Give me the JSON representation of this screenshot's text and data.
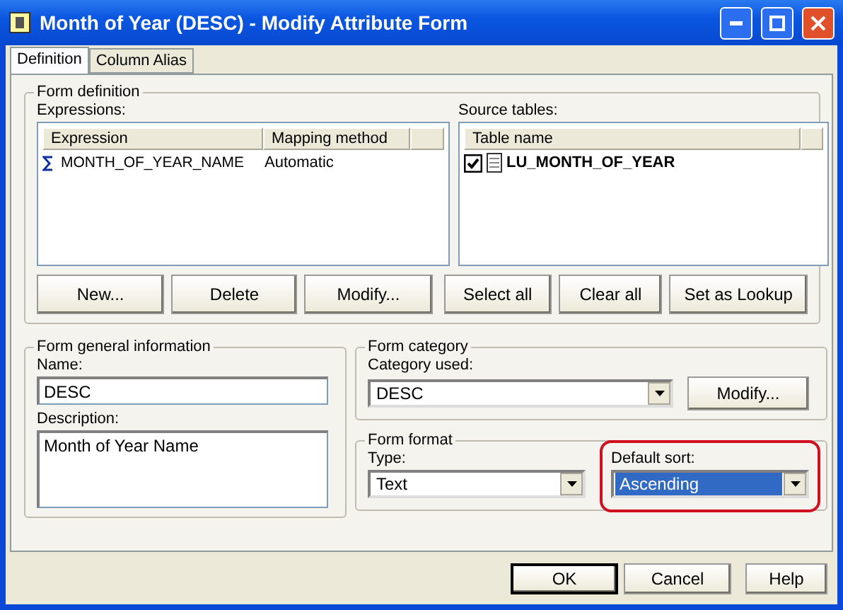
{
  "window": {
    "title": "Month of Year (DESC) - Modify Attribute Form"
  },
  "tabs": [
    {
      "label": "Definition",
      "selected": true
    },
    {
      "label": "Column Alias",
      "selected": false
    }
  ],
  "form_definition": {
    "title": "Form definition",
    "expressions": {
      "label": "Expressions:",
      "columns": [
        "Expression",
        "Mapping method"
      ],
      "rows": [
        {
          "expression": "MONTH_OF_YEAR_NAME",
          "mapping": "Automatic"
        }
      ]
    },
    "source_tables": {
      "label": "Source tables:",
      "column": "Table name",
      "rows": [
        {
          "name": "LU_MONTH_OF_YEAR",
          "checked": true
        }
      ]
    },
    "buttons": [
      "New...",
      "Delete",
      "Modify...",
      "Select all",
      "Clear all",
      "Set as Lookup"
    ]
  },
  "general": {
    "title": "Form general information",
    "name_label": "Name:",
    "name_value": "DESC",
    "description_label": "Description:",
    "description_value": "Month of Year Name"
  },
  "category": {
    "title": "Form category",
    "label": "Category used:",
    "value": "DESC",
    "button": "Modify..."
  },
  "format": {
    "title": "Form format",
    "type_label": "Type:",
    "type_value": "Text",
    "sort_label": "Default sort:",
    "sort_value": "Ascending",
    "sort_highlighted": true
  },
  "buttons": [
    {
      "label": "OK",
      "default": true
    },
    {
      "label": "Cancel",
      "default": false
    },
    {
      "label": "Help",
      "default": false
    }
  ]
}
